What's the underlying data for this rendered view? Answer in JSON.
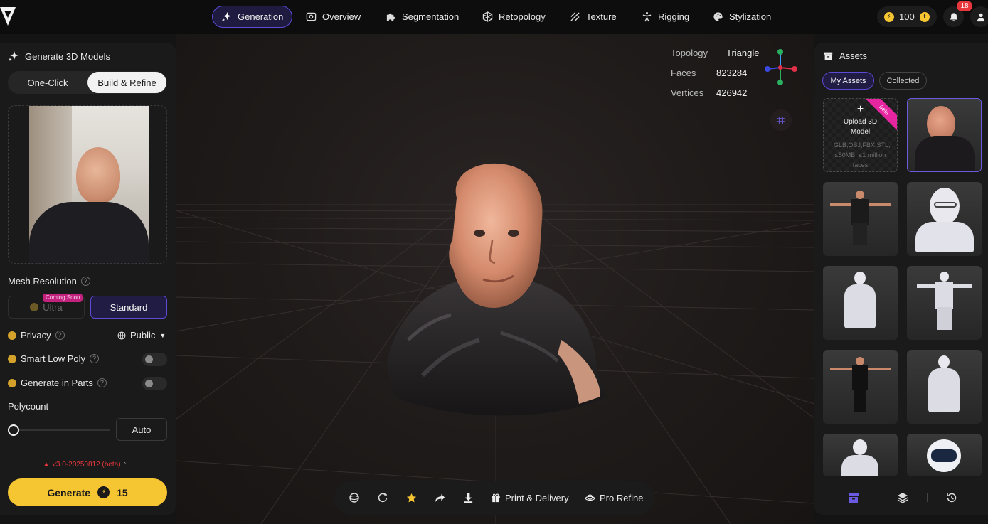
{
  "nav": {
    "tabs": [
      {
        "label": "Generation",
        "icon": "sparkle-icon",
        "active": true
      },
      {
        "label": "Overview",
        "icon": "overview-icon"
      },
      {
        "label": "Segmentation",
        "icon": "puzzle-icon"
      },
      {
        "label": "Retopology",
        "icon": "mesh-icon"
      },
      {
        "label": "Texture",
        "icon": "texture-icon"
      },
      {
        "label": "Rigging",
        "icon": "rigging-icon"
      },
      {
        "label": "Stylization",
        "icon": "palette-icon"
      }
    ],
    "credits": "100",
    "notifications": "18"
  },
  "left": {
    "title": "Generate 3D Models",
    "modes": [
      "One-Click",
      "Build & Refine"
    ],
    "active_mode": "Build & Refine",
    "mesh_resolution_label": "Mesh Resolution",
    "ultra_label": "Ultra",
    "coming_soon": "Coming Soon",
    "standard_label": "Standard",
    "privacy_label": "Privacy",
    "privacy_value": "Public",
    "smart_low_poly_label": "Smart Low Poly",
    "generate_parts_label": "Generate in Parts",
    "polycount_label": "Polycount",
    "polycount_value": "Auto",
    "version": "v3.0-20250812 (beta)",
    "generate_label": "Generate",
    "generate_cost": "15"
  },
  "viewport": {
    "stats": [
      {
        "k": "Topology",
        "v": "Triangle"
      },
      {
        "k": "Faces",
        "v": "823284"
      },
      {
        "k": "Vertices",
        "v": "426942"
      }
    ],
    "toolbar": {
      "print_label": "Print & Delivery",
      "refine_label": "Pro Refine"
    }
  },
  "assets": {
    "title": "Assets",
    "tabs": [
      "My Assets",
      "Collected"
    ],
    "upload_title": "Upload 3D Model",
    "upload_sub": "GLB,OBJ,FBX,STL, ≤50MB, ≤1 million faces",
    "beta": "Beta"
  },
  "colors": {
    "accent": "#5b4bd6",
    "generate": "#f6c532",
    "badge": "#e8373c"
  }
}
